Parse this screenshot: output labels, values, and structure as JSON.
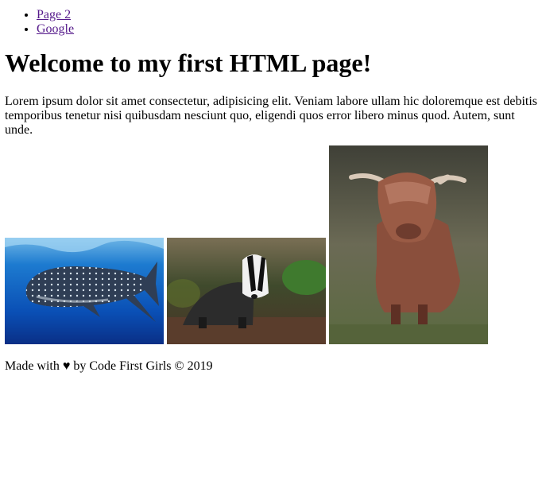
{
  "nav": {
    "links": [
      {
        "label": "Page 2"
      },
      {
        "label": "Google"
      }
    ]
  },
  "heading": "Welcome to my first HTML page!",
  "intro": "Lorem ipsum dolor sit amet consectetur, adipisicing elit. Veniam labore ullam hic doloremque est debitis temporibus tenetur nisi quibusdam nesciunt quo, eligendi quos error libero minus quod. Autem, sunt unde.",
  "gallery": {
    "images": [
      {
        "subject": "whale shark"
      },
      {
        "subject": "badger"
      },
      {
        "subject": "highland cow"
      }
    ]
  },
  "footer": {
    "made_with": "Made with",
    "heart": "♥",
    "by_text": "by Code First Girls",
    "copyright": "© 2019"
  },
  "colors": {
    "link_visited": "#551a8b",
    "text": "#000000",
    "background": "#ffffff"
  }
}
